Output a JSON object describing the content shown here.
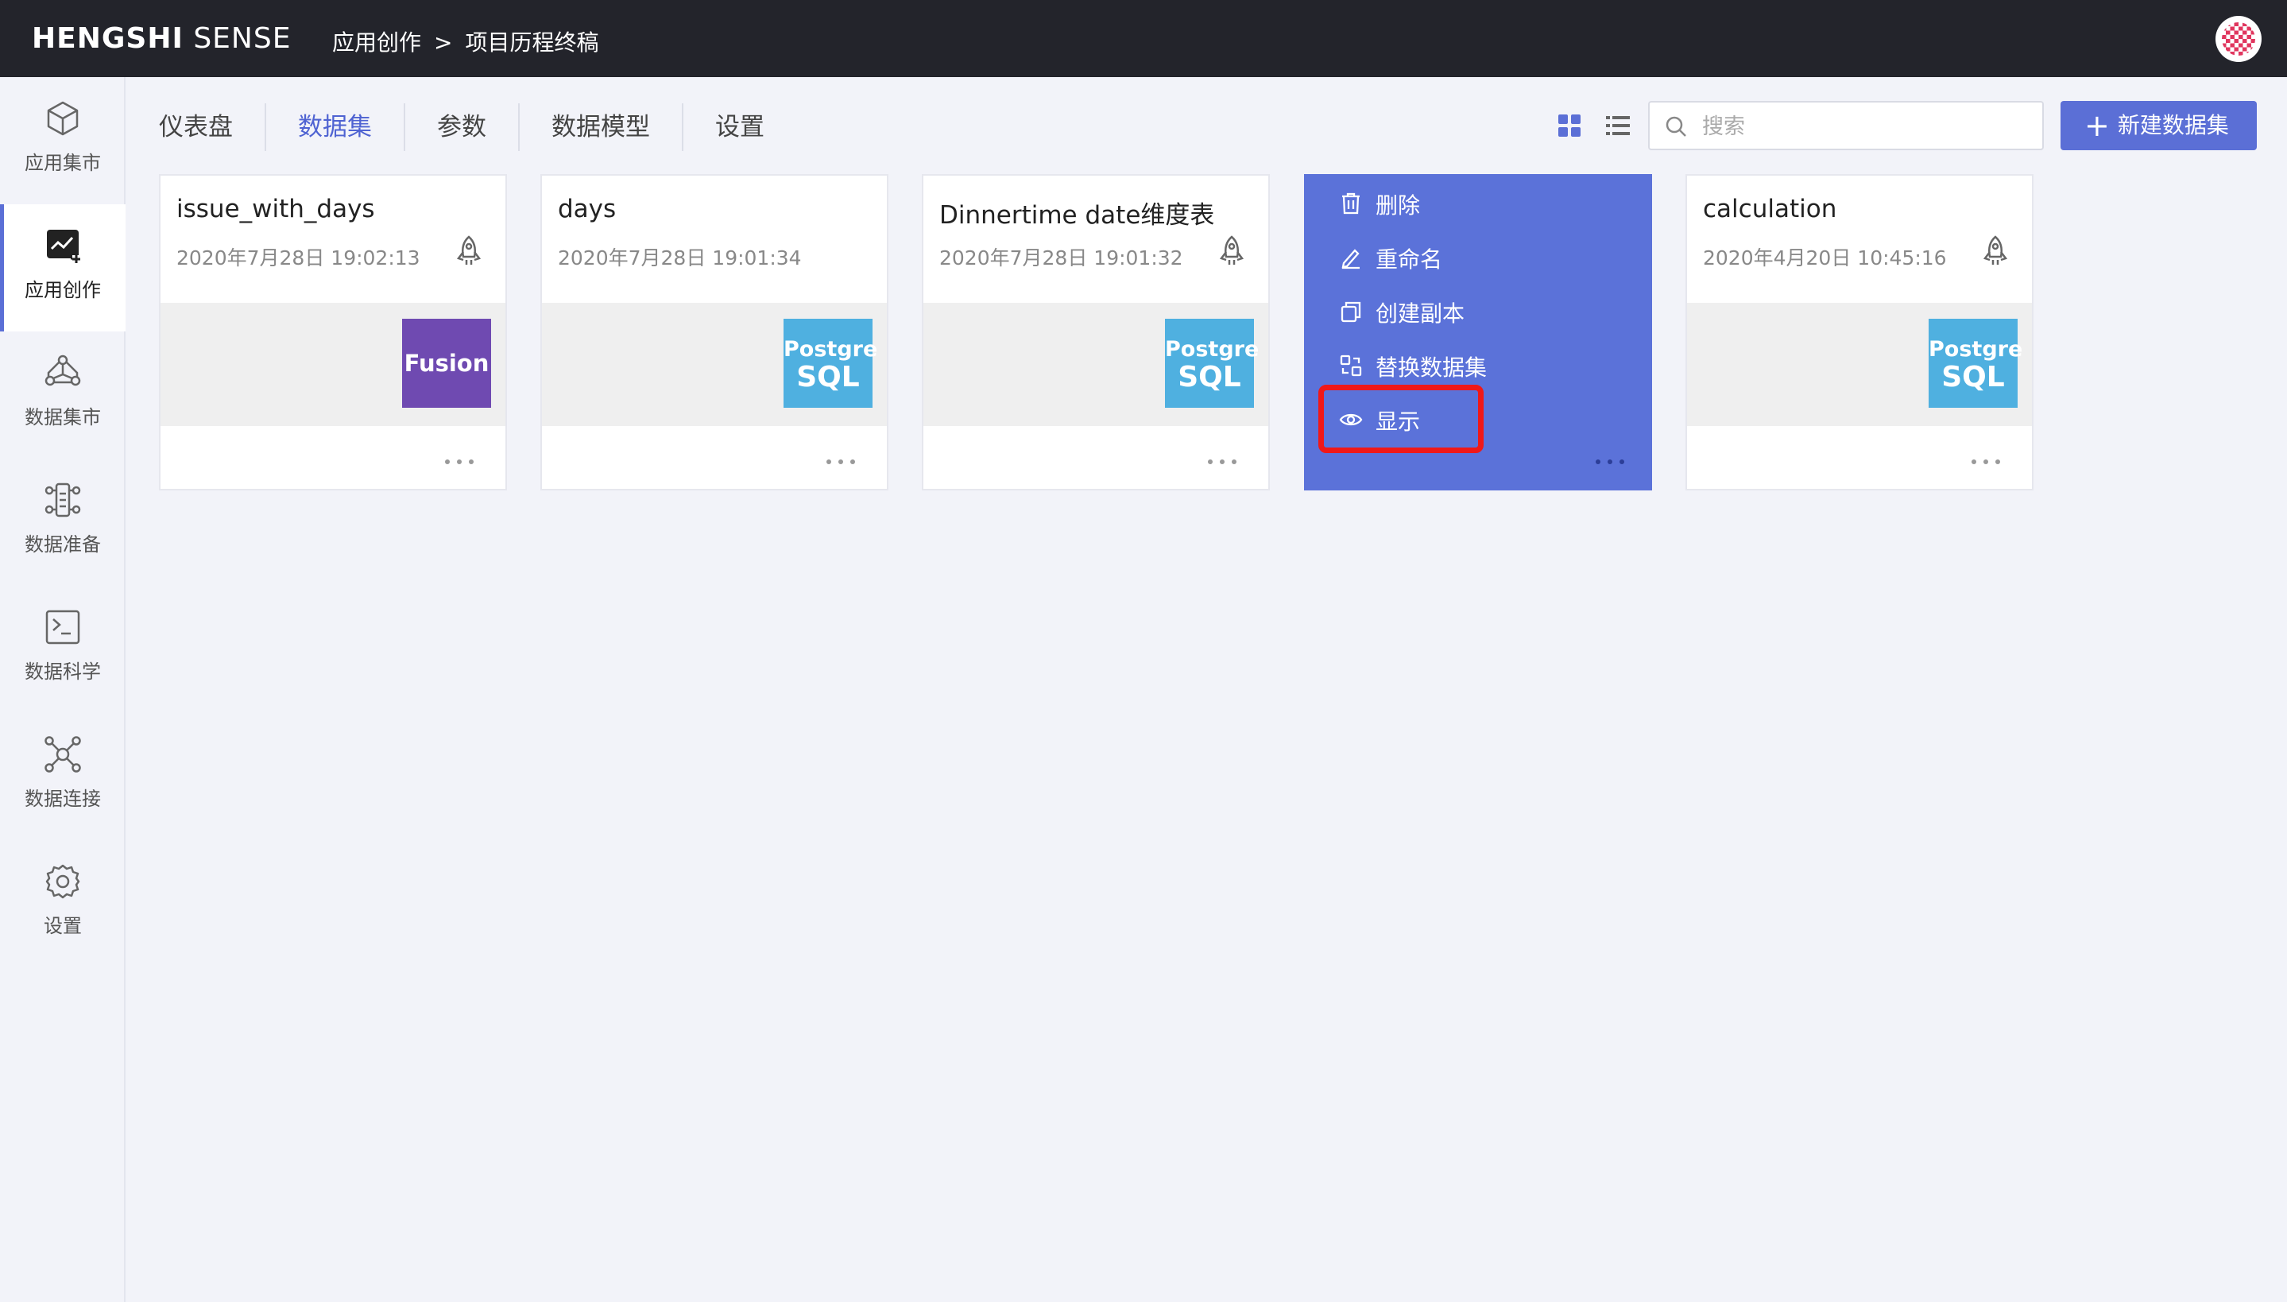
{
  "header": {
    "brand_bold": "HENGSHI",
    "brand_light": "SENSE",
    "breadcrumb": [
      "应用创作",
      "项目历程终稿"
    ],
    "breadcrumb_sep": ">"
  },
  "sidebar": {
    "items": [
      {
        "label": "应用集市",
        "icon": "cube-icon"
      },
      {
        "label": "应用创作",
        "icon": "app-create-icon",
        "active": true
      },
      {
        "label": "数据集市",
        "icon": "data-market-icon"
      },
      {
        "label": "数据准备",
        "icon": "data-prep-icon"
      },
      {
        "label": "数据科学",
        "icon": "terminal-icon"
      },
      {
        "label": "数据连接",
        "icon": "network-icon"
      },
      {
        "label": "设置",
        "icon": "gear-icon"
      }
    ]
  },
  "tabs": [
    {
      "label": "仪表盘"
    },
    {
      "label": "数据集",
      "active": true
    },
    {
      "label": "参数"
    },
    {
      "label": "数据模型"
    },
    {
      "label": "设置"
    }
  ],
  "search": {
    "placeholder": "搜索",
    "value": ""
  },
  "new_button": {
    "label": "新建数据集"
  },
  "cards": [
    {
      "title": "issue_with_days",
      "date": "2020年7月28日 19:02:13",
      "source": "Fusion"
    },
    {
      "title": "days",
      "date": "2020年7月28日 19:01:34",
      "source": "PostgreSQL"
    },
    {
      "title": "Dinnertime date维度表",
      "date": "2020年7月28日 19:01:32",
      "source": "PostgreSQL"
    },
    {
      "title": "calculation",
      "date": "2020年4月20日 10:45:16",
      "source": "PostgreSQL"
    }
  ],
  "logos": {
    "fusion": "Fusion",
    "pg_line1": "Postgre",
    "pg_line2": "SQL"
  },
  "context_menu": {
    "items": [
      {
        "label": "删除",
        "icon": "trash-icon"
      },
      {
        "label": "重命名",
        "icon": "pencil-icon"
      },
      {
        "label": "创建副本",
        "icon": "copy-icon"
      },
      {
        "label": "替换数据集",
        "icon": "replace-icon"
      },
      {
        "label": "显示",
        "icon": "eye-icon",
        "highlighted": true
      }
    ]
  },
  "colors": {
    "accent": "#5b6fd6",
    "topbar": "#23242b",
    "highlight": "#f01818"
  }
}
